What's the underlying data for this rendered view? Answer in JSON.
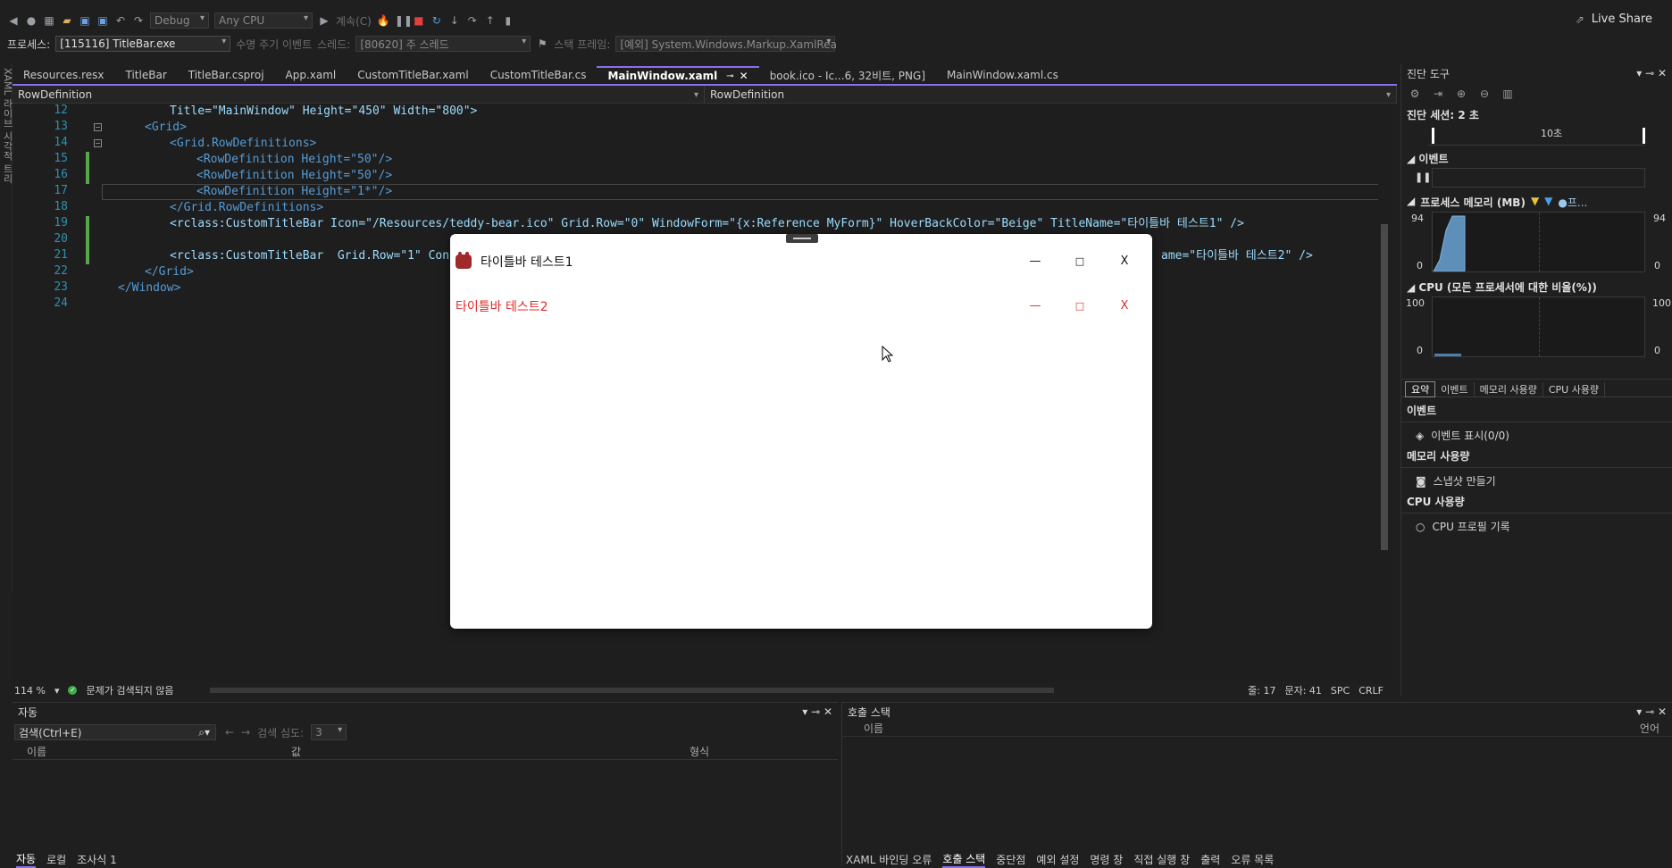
{
  "toolbar": {
    "config": "Debug",
    "platform": "Any CPU",
    "continue": "계속(C)",
    "process_label": "프로세스:",
    "process": "[115116] TitleBar.exe",
    "lifecycle": "수명 주기 이벤트",
    "thread_label": "스레드:",
    "thread": "[80620] 주 스레드",
    "stack_label": "스택 프레임:",
    "stack": "[예외] System.Windows.Markup.XamlRea",
    "live_share": "Live Share"
  },
  "side_tab": "XAML 라이브 시각적 트리",
  "tabs": [
    "Resources.resx",
    "TitleBar",
    "TitleBar.csproj",
    "App.xaml",
    "CustomTitleBar.xaml",
    "CustomTitleBar.cs",
    "MainWindow.xaml",
    "book.ico - Ic...6, 32비트, PNG]",
    "MainWindow.xaml.cs"
  ],
  "nav": {
    "left": "RowDefinition",
    "right": "RowDefinition"
  },
  "editor": {
    "line_numbers": [
      "12",
      "13",
      "14",
      "15",
      "16",
      "17",
      "18",
      "19",
      "20",
      "21",
      "22",
      "23",
      "24"
    ],
    "lines": {
      "l12": "Title=\"MainWindow\" Height=\"450\" Width=\"800\">",
      "l13": "<Grid>",
      "l14": "<Grid.RowDefinitions>",
      "l15": "<RowDefinition Height=\"50\"/>",
      "l16": "<RowDefinition Height=\"50\"/>",
      "l17": "<RowDefinition Height=\"1*\"/>",
      "l18": "</Grid.RowDefinitions>",
      "l19": "<rclass:CustomTitleBar Icon=\"/Resources/teddy-bear.ico\" Grid.Row=\"0\" WindowForm=\"{x:Reference MyForm}\" HoverBackColor=\"Beige\" TitleName=\"타이틀바 테스트1\" />",
      "l21a": "<rclass:CustomTitleBar  Grid.Row=\"1\" Content",
      "l21b": "ame=\"타이틀바 테스트2\" />",
      "l22": "</Grid>",
      "l23": "</Window>"
    }
  },
  "status": {
    "zoom": "114 %",
    "issues": "문제가 검색되지 않음",
    "line": "줄: 17",
    "char": "문자: 41",
    "spc": "SPC",
    "eol": "CRLF"
  },
  "app": {
    "title1": "타이틀바 테스트1",
    "title2": "타이틀바 테스트2",
    "min": "—",
    "max": "□",
    "close": "X"
  },
  "diag": {
    "title": "진단 도구",
    "session": "진단 세션: 2 초",
    "time_tick": "10초",
    "events": "이벤트",
    "memory": "프로세스 메모리 (MB)",
    "legend_snap": "▼",
    "legend_proc": "●프...",
    "mem_max": "94",
    "mem_min": "0",
    "cpu": "CPU (모든 프로세서에 대한 비율(%))",
    "cpu_max": "100",
    "cpu_min": "0",
    "tabs": [
      "요약",
      "이벤트",
      "메모리 사용량",
      "CPU 사용량"
    ],
    "sec_events": "이벤트",
    "show_events": "이벤트 표시(0/0)",
    "sec_memory": "메모리 사용량",
    "snapshot": "스냅샷 만들기",
    "sec_cpu": "CPU 사용량",
    "cpu_profile": "CPU 프로필 기록"
  },
  "autos": {
    "title": "자동",
    "search": "검색(Ctrl+E)",
    "depth_label": "검색 심도:",
    "depth": "3",
    "cols": [
      "이름",
      "값",
      "형식"
    ],
    "tabs": [
      "자동",
      "로컬",
      "조사식 1"
    ]
  },
  "callstack": {
    "title": "호출 스택",
    "cols": [
      "이름",
      "언어"
    ],
    "tabs": [
      "XAML 바인딩 오류",
      "호출 스택",
      "중단점",
      "예외 설정",
      "명령 창",
      "직접 실행 창",
      "출력",
      "오류 목록"
    ]
  },
  "chart_data": {
    "type": "area",
    "title": "프로세스 메모리 (MB)",
    "ylim": [
      0,
      94
    ],
    "series": [
      {
        "name": "프...",
        "values": [
          0,
          20,
          70,
          94,
          94,
          94
        ]
      }
    ]
  }
}
